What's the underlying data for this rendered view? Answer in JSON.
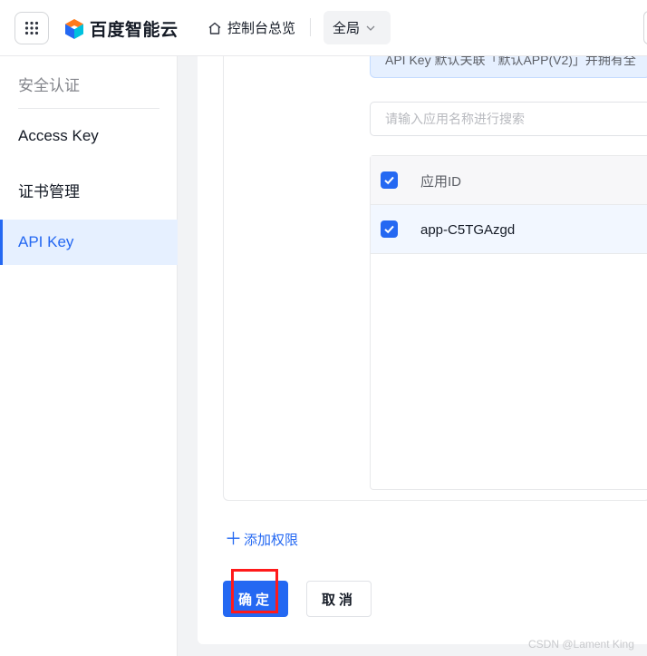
{
  "header": {
    "brand_name": "百度智能云",
    "home_label": "控制台总览",
    "region_label": "全局"
  },
  "sidebar": {
    "title": "安全认证",
    "items": [
      {
        "label": "Access Key",
        "active": false
      },
      {
        "label": "证书管理",
        "active": false
      },
      {
        "label": "API Key",
        "active": true
      }
    ]
  },
  "main": {
    "notice_text": "API Key 默认关联「默认APP(V2)」并拥有全",
    "search": {
      "placeholder": "请输入应用名称进行搜索"
    },
    "table": {
      "header_label": "应用ID",
      "header_checked": true,
      "rows": [
        {
          "app_id": "app-C5TGAzgd",
          "checked": true
        }
      ]
    },
    "add_permission_label": "添加权限",
    "confirm_label": "确定",
    "cancel_label": "取消"
  },
  "watermark": "CSDN @Lament King",
  "colors": {
    "accent": "#2468f2",
    "active_bg": "#e6f0ff",
    "highlight": "#ff1a1a"
  }
}
